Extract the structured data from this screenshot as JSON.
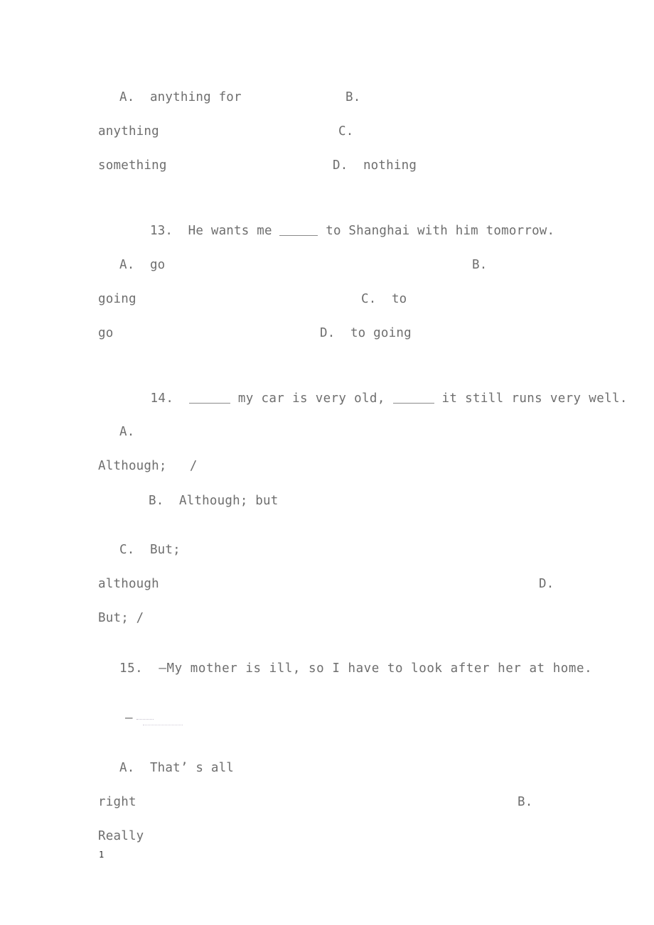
{
  "document": {
    "type": "english-grammar-worksheet",
    "background_color": "#ffffff",
    "text_color": "#6e6e6e",
    "page_number": "1"
  },
  "lines": {
    "q12_options_line1_left": "A.  anything for",
    "q12_options_line1_right": "B.",
    "q12_options_line2_left": "anything",
    "q12_options_line2_right": "C.",
    "q12_options_line3_left": "something",
    "q12_options_line3_right": "D.  nothing",
    "q13_stem_before": "13.  He wants me ",
    "q13_stem_after": " to Shanghai with him tomorrow.",
    "q13_options_line1_left": "A.  go",
    "q13_options_line1_right": "B.",
    "q13_options_line2_left": "going",
    "q13_options_line2_right": "C.  to",
    "q13_options_line3_left": "go",
    "q13_options_line3_right": "D.  to going",
    "q14_stem_part1": "14.  ",
    "q14_stem_part2": " my car is very old, ",
    "q14_stem_part3": " it still runs very well.",
    "q14_option_a_marker": "A.",
    "q14_option_a_text": "Although;   /",
    "q14_option_b": "B.  Although; but",
    "q14_option_c_marker": "C.  But;",
    "q14_option_c_text": "although",
    "q14_option_d_marker": "D.",
    "q14_option_d_text": "But; /",
    "q15_stem": "15.  —My mother is ill, so I have to look after her at home.",
    "q15_answer_dash": "—",
    "q15_options_line1_left": "A.  That’ s all",
    "q15_options_line2_left": "right",
    "q15_options_line2_right": "B.",
    "q15_options_line3_left": "Really"
  }
}
